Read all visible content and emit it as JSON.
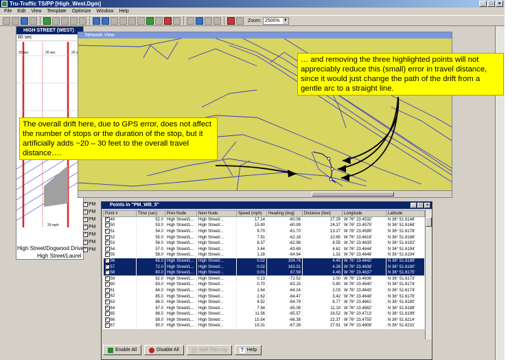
{
  "app": {
    "title": "Tru-Traffic TS/PP [High_West.Dgm]",
    "window_controls": [
      "_",
      "□",
      "×"
    ]
  },
  "menu": [
    "File",
    "Edit",
    "View",
    "Template",
    "Optimize",
    "Window",
    "Help"
  ],
  "toolbar": {
    "zoom_label": "Zoom:",
    "zoom_value": "2500%"
  },
  "tsd_window": {
    "title": "HIGH STREET (WEST)",
    "speed_row": "80 sec",
    "street_1": "High Street/Dogwood Drive",
    "street_2": "High Street/Laurel"
  },
  "network_view": {
    "title": "Network View"
  },
  "callouts": {
    "left": "The overall drift here, due to GPS error, does not affect the number of stops or the duration of the stop, but it artificially adds ~20 – 30 feet to the overall travel distance….",
    "right": "… and removing the three highlighted points will not appreciably reduce this (small) error in travel distance, since it would just change the path of the drift from a gentle arc to a straight line."
  },
  "pm_labels": [
    "PM",
    "PM",
    "PM",
    "PM",
    "PM",
    "PM",
    "PM"
  ],
  "points_window": {
    "title": "Points in \"PM_WB_5\"",
    "columns": [
      "Point #",
      "Time (sec)",
      "Prev Node",
      "Next Node",
      "Speed (mph)",
      "Heading (deg)",
      "Distance (feet)",
      "Longitude",
      "Latitude"
    ],
    "rows": [
      {
        "pt": "49",
        "time": "52.0",
        "prev": "High Street/L...",
        "next": "High Street/...",
        "speed": "17.14",
        "heading": "-60.06",
        "dist": "27.29",
        "lon": "W 76° 23.4532'",
        "lat": "N 36° 51.6148'",
        "sel": false
      },
      {
        "pt": "50",
        "time": "53.0",
        "prev": "High Street/L...",
        "next": "High Street/...",
        "speed": "15.90",
        "heading": "-60.99",
        "dist": "24.37",
        "lon": "W 76° 23.4575'",
        "lat": "N 36° 51.6168'",
        "sel": false
      },
      {
        "pt": "51",
        "time": "54.0",
        "prev": "High Street/L...",
        "next": "High Street/...",
        "speed": "9.70",
        "heading": "-61.70",
        "dist": "13.27",
        "lon": "W 76° 23.4599'",
        "lat": "N 36° 51.6178'",
        "sel": false
      },
      {
        "pt": "52",
        "time": "55.0",
        "prev": "High Street/L...",
        "next": "High Street/...",
        "speed": "7.91",
        "heading": "-62.18",
        "dist": "10.65",
        "lon": "W 76° 23.4619'",
        "lat": "N 36° 51.6186'",
        "sel": false
      },
      {
        "pt": "53",
        "time": "56.0",
        "prev": "High Street/L...",
        "next": "High Street/...",
        "speed": "6.37",
        "heading": "-62.98",
        "dist": "8.55",
        "lon": "W 76° 23.4635'",
        "lat": "N 36° 51.6192'",
        "sel": false
      },
      {
        "pt": "54",
        "time": "57.0",
        "prev": "High Street/L...",
        "next": "High Street/...",
        "speed": "3.64",
        "heading": "-63.69",
        "dist": "4.62",
        "lon": "W 76° 23.4644'",
        "lat": "N 36° 51.6194'",
        "sel": false
      },
      {
        "pt": "55",
        "time": "58.0",
        "prev": "High Street/L...",
        "next": "High Street/...",
        "speed": "1.28",
        "heading": "-64.94",
        "dist": "1.32",
        "lon": "W 76° 23.4646'",
        "lat": "N 36° 51.6194'",
        "sel": false
      },
      {
        "pt": "56",
        "time": "65.0",
        "prev": "High Street/L...",
        "next": "High Street/...",
        "speed": "0.02",
        "heading": "104.74",
        "dist": "4.45",
        "lon": "W 76° 23.4642'",
        "lat": "N 36° 51.6188'",
        "sel": true
      },
      {
        "pt": "57",
        "time": "72.0",
        "prev": "High Street/L...",
        "next": "High Street/...",
        "speed": "0.02",
        "heading": "163.31",
        "dist": "4.26",
        "lon": "W 76° 23.4638'",
        "lat": "N 36° 51.6180'",
        "sel": true
      },
      {
        "pt": "58",
        "time": "80.0",
        "prev": "High Street/L...",
        "next": "High Street/...",
        "speed": "0.01",
        "heading": "67.59",
        "dist": "4.46",
        "lon": "W 76° 23.4637'",
        "lat": "N 36° 51.6175'",
        "sel": true
      },
      {
        "pt": "59",
        "time": "82.0",
        "prev": "High Street/L...",
        "next": "High Street/...",
        "speed": "0.13",
        "heading": "-72.52",
        "dist": "1.00",
        "lon": "W 76° 23.4636'",
        "lat": "N 36° 51.6173'",
        "sel": false
      },
      {
        "pt": "60",
        "time": "83.0",
        "prev": "High Street/L...",
        "next": "High Street/...",
        "speed": "0.70",
        "heading": "-63.15",
        "dist": "0.80",
        "lon": "W 76° 23.4640'",
        "lat": "N 36° 51.6174'",
        "sel": false
      },
      {
        "pt": "61",
        "time": "84.0",
        "prev": "High Street/L...",
        "next": "High Street/...",
        "speed": "1.64",
        "heading": "-64.24",
        "dist": "2.03",
        "lon": "W 76° 23.4643'",
        "lat": "N 36° 51.6174'",
        "sel": false
      },
      {
        "pt": "62",
        "time": "85.0",
        "prev": "High Street/L...",
        "next": "High Street/...",
        "speed": "2.62",
        "heading": "-64.47",
        "dist": "3.42",
        "lon": "W 76° 23.4648'",
        "lat": "N 36° 51.6176'",
        "sel": false
      },
      {
        "pt": "63",
        "time": "86.0",
        "prev": "High Street/L...",
        "next": "High Street/...",
        "speed": "4.92",
        "heading": "-64.79",
        "dist": "6.77",
        "lon": "W 76° 23.4661'",
        "lat": "N 36° 51.6180'",
        "sel": false
      },
      {
        "pt": "64",
        "time": "87.0",
        "prev": "High Street/L...",
        "next": "High Street/...",
        "speed": "7.94",
        "heading": "-65.08",
        "dist": "11.19",
        "lon": "W 76° 23.4682'",
        "lat": "N 36° 51.6188'",
        "sel": false
      },
      {
        "pt": "65",
        "time": "88.0",
        "prev": "High Street/L...",
        "next": "High Street/...",
        "speed": "11.56",
        "heading": "-65.57",
        "dist": "16.52",
        "lon": "W 76° 23.4713'",
        "lat": "N 36° 51.6199'",
        "sel": false
      },
      {
        "pt": "66",
        "time": "89.0",
        "prev": "High Street/L...",
        "next": "High Street/...",
        "speed": "15.54",
        "heading": "-66.38",
        "dist": "22.37",
        "lon": "W 76° 23.4755'",
        "lat": "N 36° 51.6214'",
        "sel": false
      },
      {
        "pt": "67",
        "time": "90.0",
        "prev": "High Street/L...",
        "next": "High Street/...",
        "speed": "19.31",
        "heading": "-67.28",
        "dist": "27.91",
        "lon": "W 76° 23.4808'",
        "lat": "N 36° 51.6231'",
        "sel": false
      }
    ],
    "buttons": {
      "enable_all": "Enable All",
      "disable_all": "Disable All",
      "split": "Split Trip Log",
      "help": "Help"
    }
  },
  "colors": {
    "map_bg": "#d8d560",
    "selection": "#0a246a",
    "callout": "#ffff00"
  }
}
